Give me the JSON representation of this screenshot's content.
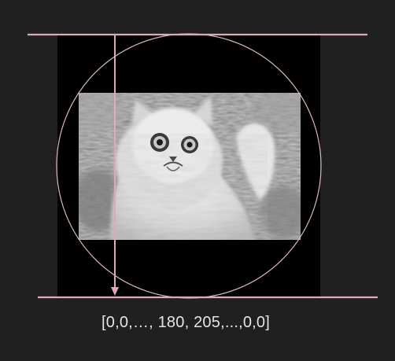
{
  "diagram": {
    "caption": "[0,0,…, 180, 205,...,0,0]",
    "image_subject": "grayscale photo of a wide-eyed white long-haired cat in grass",
    "colors": {
      "background": "#202020",
      "frame": "#000000",
      "accent_line": "#e0a8be",
      "circle": "#dcb6c8",
      "caption_text": "#e4e4e4"
    }
  }
}
